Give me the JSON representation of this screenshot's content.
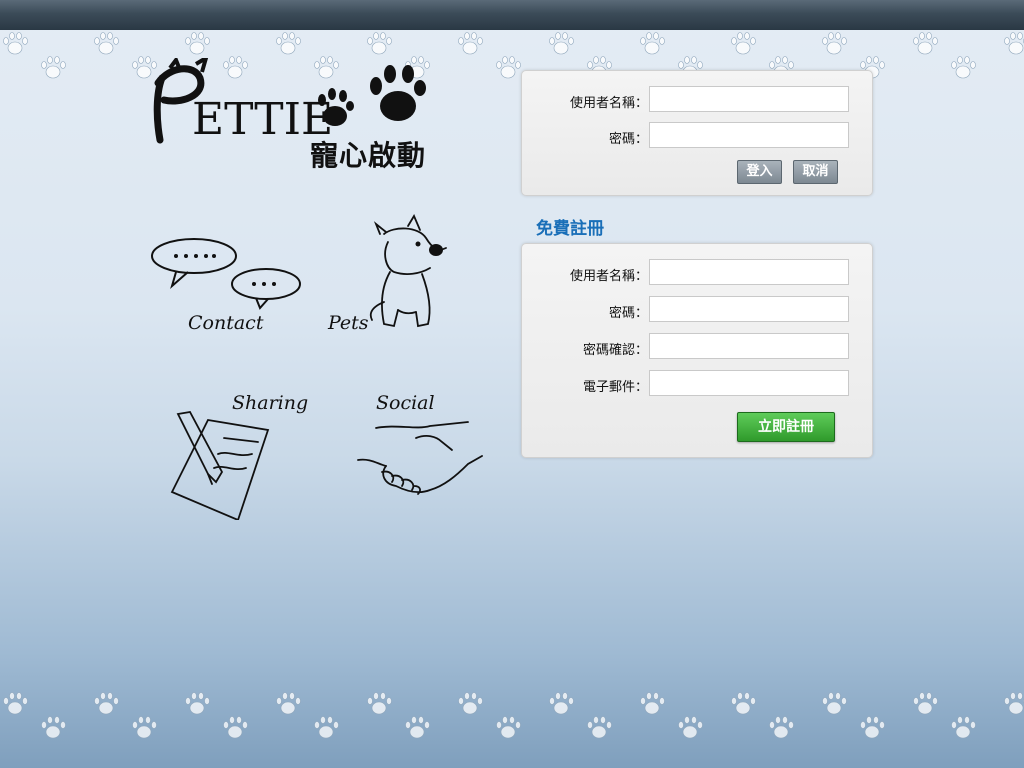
{
  "logo": {
    "brand": "ETTIE",
    "brand_initial": "P",
    "tagline": "寵心啟動"
  },
  "features": [
    {
      "label": "Contact",
      "icon": "speech-bubbles-icon"
    },
    {
      "label": "Pets",
      "icon": "dog-icon"
    },
    {
      "label": "Sharing",
      "icon": "pen-paper-icon"
    },
    {
      "label": "Social",
      "icon": "handshake-icon"
    }
  ],
  "login": {
    "username_label": "使用者名稱：",
    "password_label": "密碼：",
    "username_value": "",
    "password_value": "",
    "login_button": "登入",
    "cancel_button": "取消"
  },
  "register": {
    "title": "免費註冊",
    "username_label": "使用者名稱：",
    "password_label": "密碼：",
    "confirm_label": "密碼確認：",
    "email_label": "電子郵件：",
    "username_value": "",
    "password_value": "",
    "confirm_value": "",
    "email_value": "",
    "submit_button": "立即註冊"
  },
  "colors": {
    "accent": "#1a6fb8",
    "register_button": "#3aa835",
    "topbar": "#3b4b58"
  }
}
